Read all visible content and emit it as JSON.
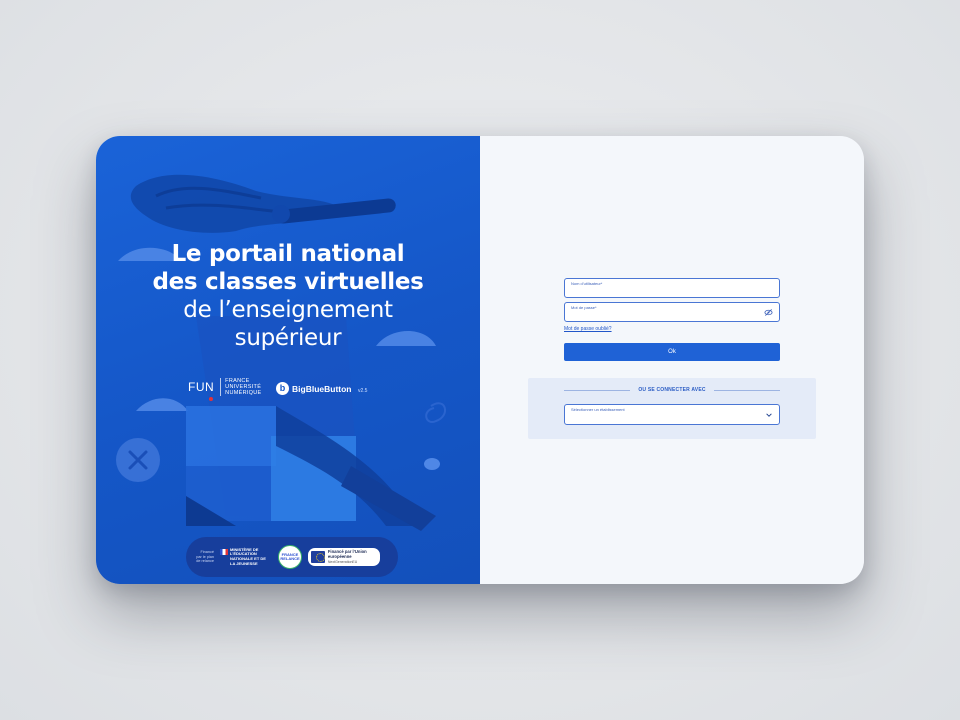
{
  "headline": {
    "line1": "Le portail national",
    "line2": "des classes virtuelles",
    "line3": "de l’enseignement",
    "line4": "supérieur"
  },
  "fun": {
    "mark": "FUN",
    "text": "FRANCE UNIVERSITÉ NUMÉRIQUE"
  },
  "bbb": {
    "name": "BigBlueButton",
    "version": "v2.5"
  },
  "partners": {
    "plan_text": "Financé par le plan de relance",
    "ministry": "MINISTÈRE DE L’ÉDUCATION NATIONALE ET DE LA JEUNESSE",
    "relance": "FRANCE RELANCE",
    "eu_title": "Financé par l’Union européenne",
    "eu_sub": "NextGenerationEU"
  },
  "login": {
    "username_label": "Nom d’utilisateur*",
    "password_label": "Mot de passe*",
    "forgot_link": "Mot de passe oublié?",
    "ok_label": "Ok"
  },
  "alt_login": {
    "divider_text": "OU SE CONNECTER AVEC",
    "select_label": "Sélectionner un établissement"
  },
  "colors": {
    "brand_blue": "#1557c8",
    "button_blue": "#1f62d6",
    "panel_bg": "#f4f7fb"
  }
}
